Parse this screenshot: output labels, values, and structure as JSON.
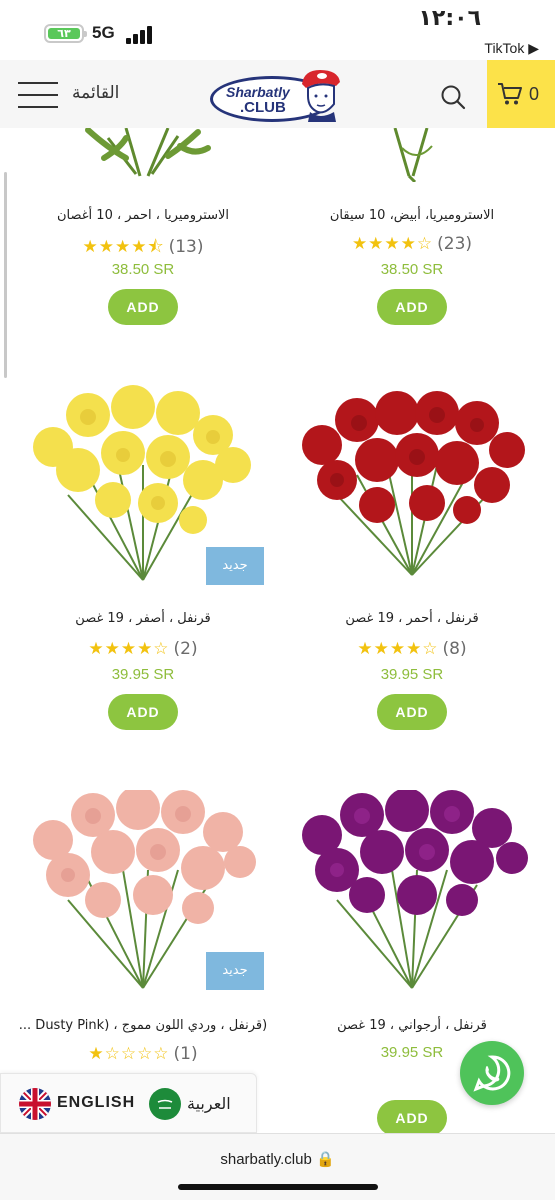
{
  "status_bar": {
    "battery": "٦٣",
    "network": "5G",
    "time": "١٢:٠٦",
    "back_app": "TikTok"
  },
  "header": {
    "menu_label": "القائمة",
    "logo_line1": "Sharbatly",
    "logo_line2": ".CLUB",
    "cart_count": "0",
    "accent_color": "#fce249"
  },
  "products": [
    {
      "title": "الاستروميريا، أبيض، 10 سيقان",
      "stars": 4,
      "rating_count": "(23)",
      "price": "38.50 SR",
      "add_label": "ADD",
      "flower_color": "#ffffff"
    },
    {
      "title": "الاستروميريا ، احمر ، 10 أغصان",
      "stars": 4.5,
      "rating_count": "(13)",
      "price": "38.50 SR",
      "add_label": "ADD",
      "flower_color": "#c62a2a"
    },
    {
      "title": "قرنفل ، أحمر ، 19 غصن",
      "stars": 4,
      "rating_count": "(8)",
      "price": "39.95 SR",
      "add_label": "ADD",
      "flower_color": "#b3161b"
    },
    {
      "title": "قرنفل ، أصفر ، 19 غصن",
      "stars": 4,
      "rating_count": "(2)",
      "price": "39.95 SR",
      "add_label": "ADD",
      "badge": "جديد",
      "flower_color": "#f4e04d"
    },
    {
      "title": "قرنفل ، أرجواني ، 19 غصن",
      "price": "39.95 SR",
      "add_label": "ADD",
      "flower_color": "#7a1674"
    },
    {
      "title": "... Dusty Pink) ، قرنفل ، وردي اللون مموج)",
      "stars": 1,
      "rating_count": "(1)",
      "badge": "جديد",
      "flower_color": "#f0b3a6"
    }
  ],
  "language": {
    "english_label": "ENGLISH",
    "arabic_label": "العربية"
  },
  "browser": {
    "url": "sharbatly.club 🔒"
  }
}
